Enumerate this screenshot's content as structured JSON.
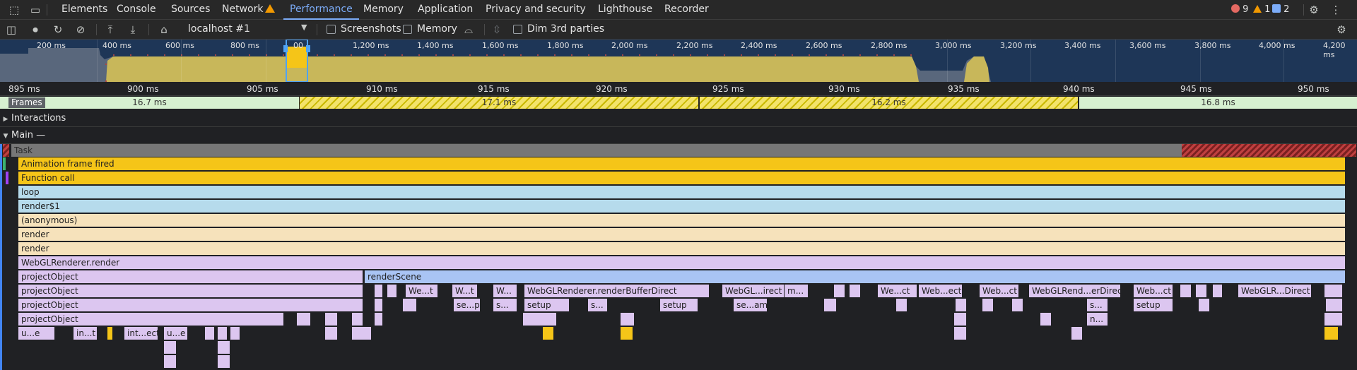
{
  "tabs": {
    "elements": "Elements",
    "console": "Console",
    "sources": "Sources",
    "network": "Network",
    "performance": "Performance",
    "memory": "Memory",
    "application": "Application",
    "privacy": "Privacy and security",
    "lighthouse": "Lighthouse",
    "recorder": "Recorder"
  },
  "badges": {
    "errors": "9",
    "warnings": "1",
    "issues": "2"
  },
  "toolbar": {
    "target": "localhost #1",
    "screenshots": "Screenshots",
    "memory": "Memory",
    "dim": "Dim 3rd parties"
  },
  "overview": {
    "ticks": [
      "200 ms",
      "400 ms",
      "600 ms",
      "800 ms",
      "00",
      "1,200 ms",
      "1,400 ms",
      "1,600 ms",
      "1,800 ms",
      "2,000 ms",
      "2,200 ms",
      "2,400 ms",
      "2,600 ms",
      "2,800 ms",
      "3,000 ms",
      "3,200 ms",
      "3,400 ms",
      "3,600 ms",
      "3,800 ms",
      "4,000 ms",
      "4,200 ms"
    ]
  },
  "ruler": {
    "ticks": [
      "895 ms",
      "900 ms",
      "905 ms",
      "910 ms",
      "915 ms",
      "920 ms",
      "925 ms",
      "930 ms",
      "935 ms",
      "940 ms",
      "945 ms",
      "950 ms"
    ]
  },
  "frames": {
    "label": "Frames",
    "items": [
      {
        "text": "16.7 ms",
        "kind": "ok"
      },
      {
        "text": "17.1 ms",
        "kind": "partial"
      },
      {
        "text": "16.2 ms",
        "kind": "partial"
      },
      {
        "text": "16.8 ms",
        "kind": "ok"
      }
    ]
  },
  "tracks": {
    "interactions": "Interactions",
    "main": "Main —"
  },
  "flame": {
    "task": "Task",
    "anim": "Animation frame fired",
    "func": "Function call",
    "loop": "loop",
    "render1": "render$1",
    "anon": "(anonymous)",
    "render_a": "render",
    "render_b": "render",
    "webgl": "WebGLRenderer.render",
    "po1": "projectObject",
    "po2": "projectObject",
    "po3": "projectObject",
    "po4": "projectObject",
    "renderScene": "renderScene",
    "row10": [
      "We...t",
      "W...t",
      "W...",
      "WebGLRenderer.renderBufferDirect",
      "WebGL...irect",
      "m...",
      "We...ct",
      "Web...ect",
      "Web...ct",
      "WebGLRend...erDirect",
      "Web...ct",
      "WebGLR...Direct"
    ],
    "row11": [
      "se...p",
      "s...",
      "setup",
      "s...",
      "setup",
      "se...am",
      "s...",
      "setup"
    ],
    "row12": [
      "n..."
    ],
    "row13": [
      "u...e",
      "in...t",
      "int...ect",
      "u...e"
    ]
  },
  "colors": {
    "accent": "#7cacf8",
    "animation": "#f5c518",
    "js": "#dcc6f0"
  }
}
